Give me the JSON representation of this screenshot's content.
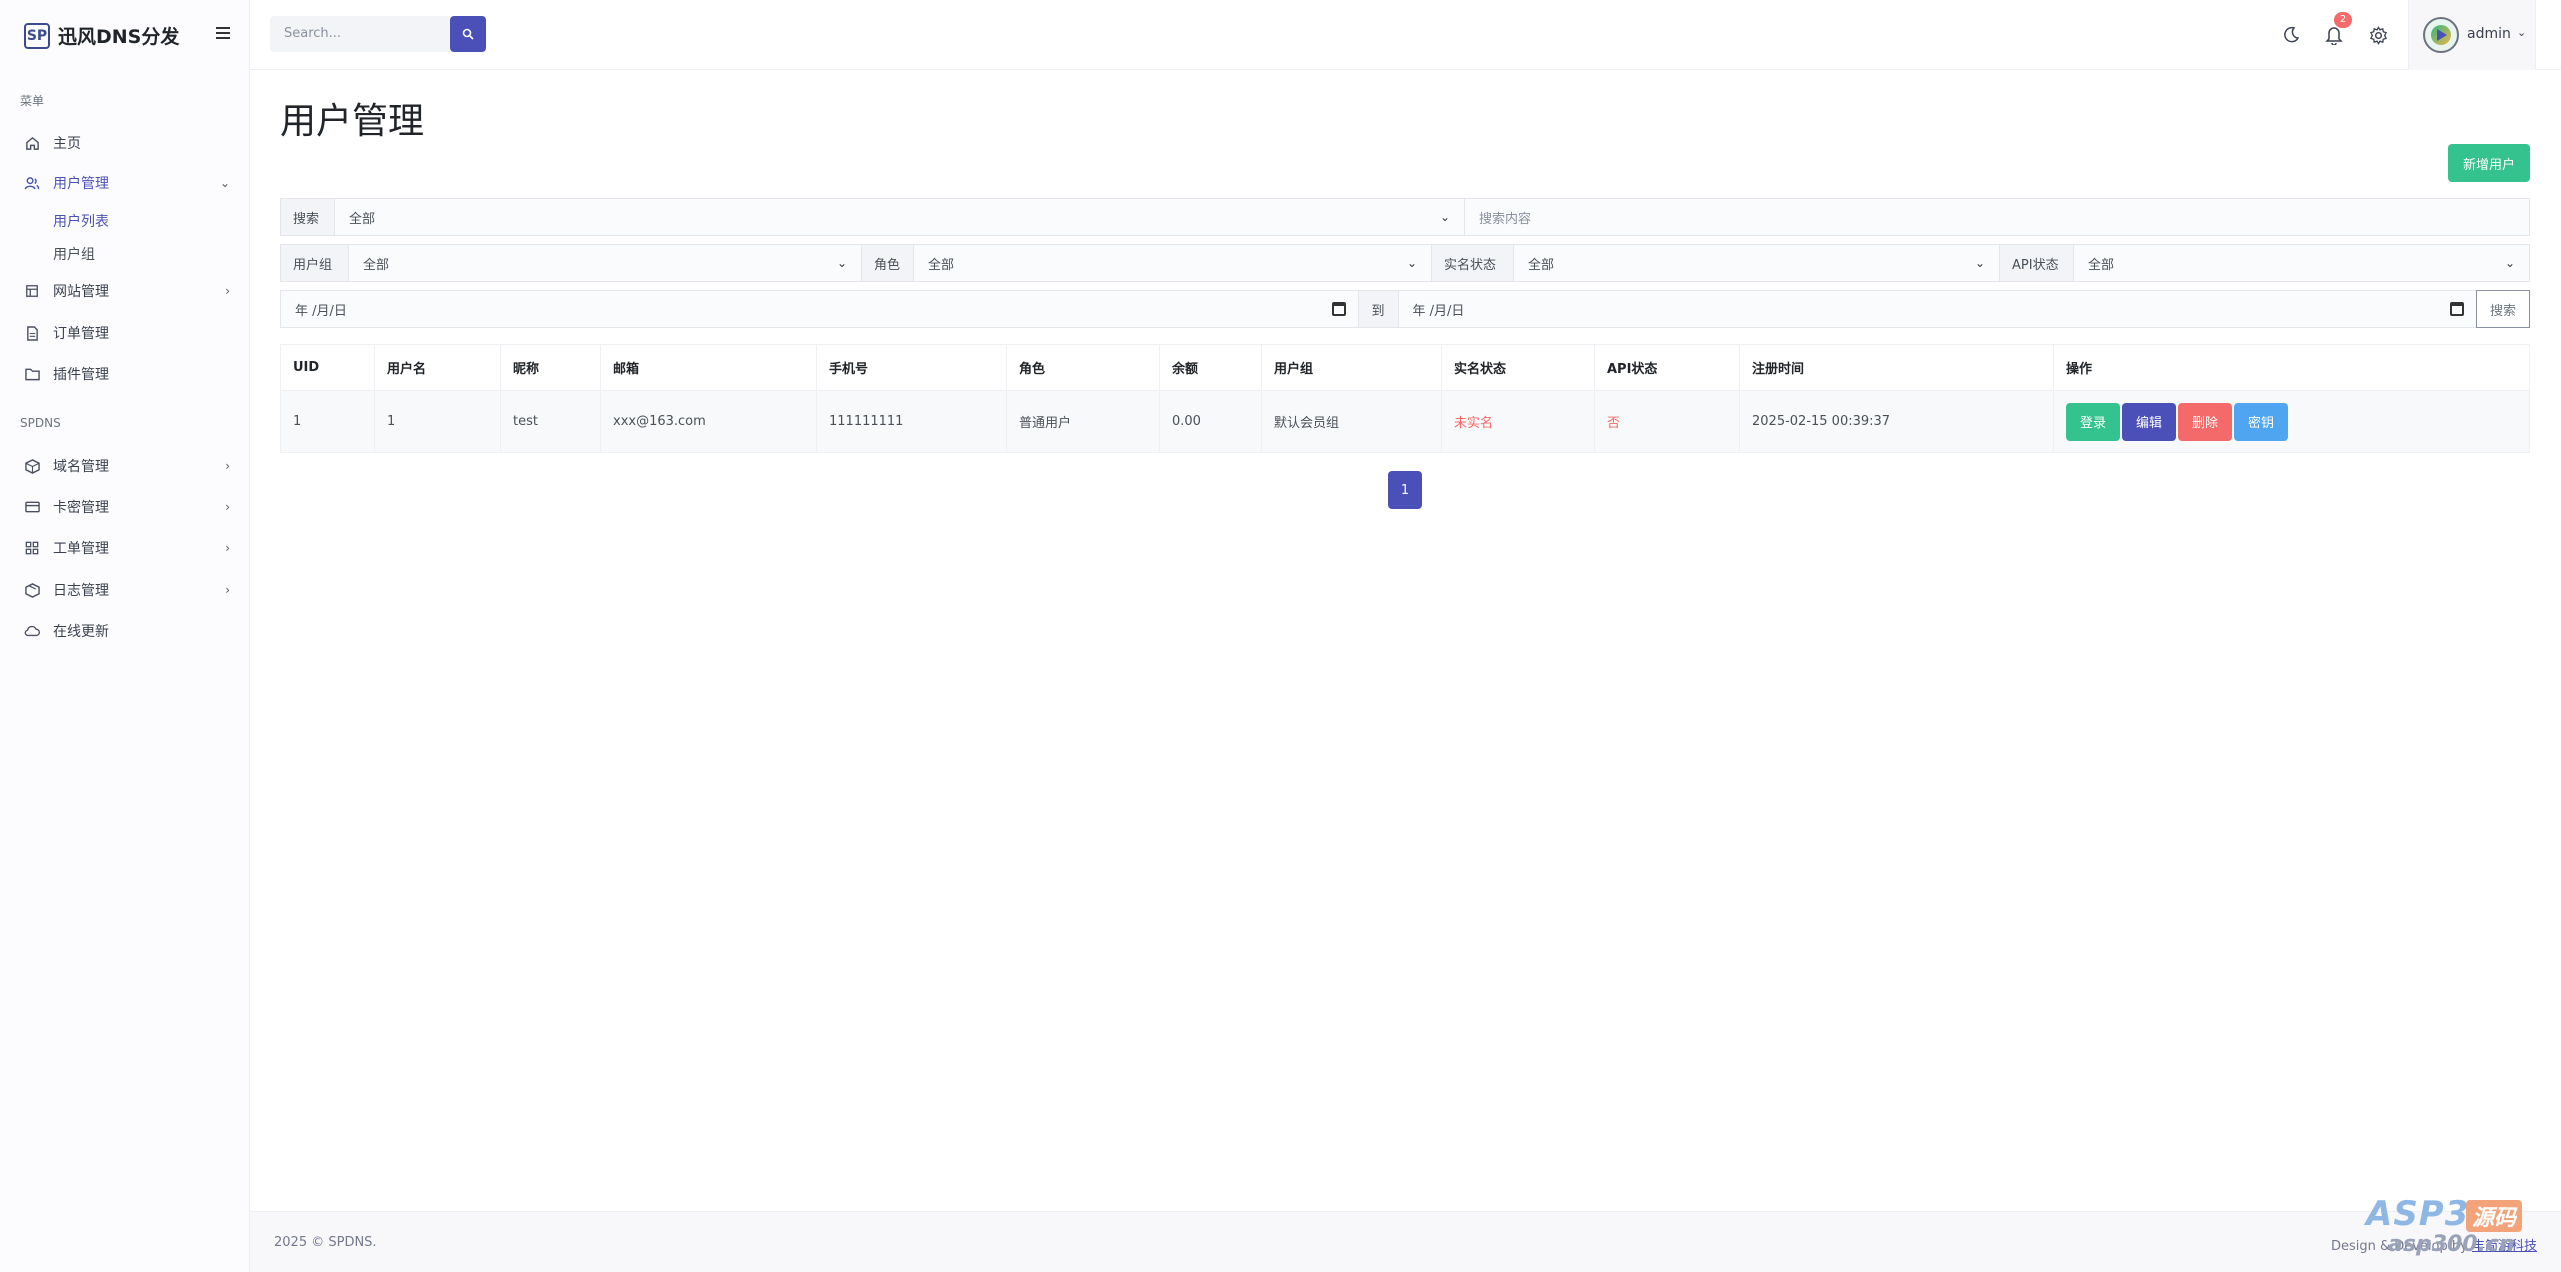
{
  "brand": {
    "logo": "SP",
    "name": "迅风DNS分发"
  },
  "sidebar": {
    "section_menu": "菜单",
    "section_spdns": "SPDNS",
    "items": [
      {
        "label": "主页",
        "icon": "home-icon"
      },
      {
        "label": "用户管理",
        "icon": "users-icon",
        "expanded": true
      },
      {
        "label": "网站管理",
        "icon": "table-icon"
      },
      {
        "label": "订单管理",
        "icon": "file-icon"
      },
      {
        "label": "插件管理",
        "icon": "folder-icon"
      }
    ],
    "sub_items": [
      {
        "label": "用户列表",
        "active": true
      },
      {
        "label": "用户组"
      }
    ],
    "spdns_items": [
      {
        "label": "域名管理",
        "icon": "cube-icon"
      },
      {
        "label": "卡密管理",
        "icon": "card-icon"
      },
      {
        "label": "工单管理",
        "icon": "grid-icon"
      },
      {
        "label": "日志管理",
        "icon": "box-icon"
      },
      {
        "label": "在线更新",
        "icon": "cloud-icon"
      }
    ]
  },
  "topbar": {
    "search_placeholder": "Search...",
    "notification_count": "2",
    "username": "admin"
  },
  "page": {
    "title": "用户管理",
    "add_button": "新增用户"
  },
  "filters": {
    "search_label": "搜索",
    "search_field": "全部",
    "search_placeholder": "搜索内容",
    "group_label": "用户组",
    "group_value": "全部",
    "role_label": "角色",
    "role_value": "全部",
    "realname_label": "实名状态",
    "realname_value": "全部",
    "api_label": "API状态",
    "api_value": "全部",
    "date_from": "年 /月/日",
    "date_sep": "到",
    "date_to": "年 /月/日",
    "submit": "搜索"
  },
  "table": {
    "headers": [
      "UID",
      "用户名",
      "昵称",
      "邮箱",
      "手机号",
      "角色",
      "余额",
      "用户组",
      "实名状态",
      "API状态",
      "注册时间",
      "操作"
    ],
    "rows": [
      {
        "uid": "1",
        "username": "1",
        "nickname": "test",
        "email": "xxx@163.com",
        "phone": "111111111",
        "role": "普通用户",
        "balance": "0.00",
        "group": "默认会员组",
        "realname": "未实名",
        "api": "否",
        "registered": "2025-02-15 00:39:37"
      }
    ],
    "actions": {
      "login": "登录",
      "edit": "编辑",
      "delete": "删除",
      "key": "密钥"
    }
  },
  "pagination": {
    "current": "1"
  },
  "footer": {
    "copyright": "2025 © SPDNS.",
    "credit_prefix": "Design & Develop by",
    "credit_link": "丰简游科技"
  },
  "watermark": {
    "line1": "ASP300",
    "badge": "源码",
    "line2": "asp300.cn"
  },
  "colors": {
    "primary": "#4b4fb8",
    "success": "#34c38f",
    "danger": "#f46a6a",
    "info": "#50a5f1"
  }
}
